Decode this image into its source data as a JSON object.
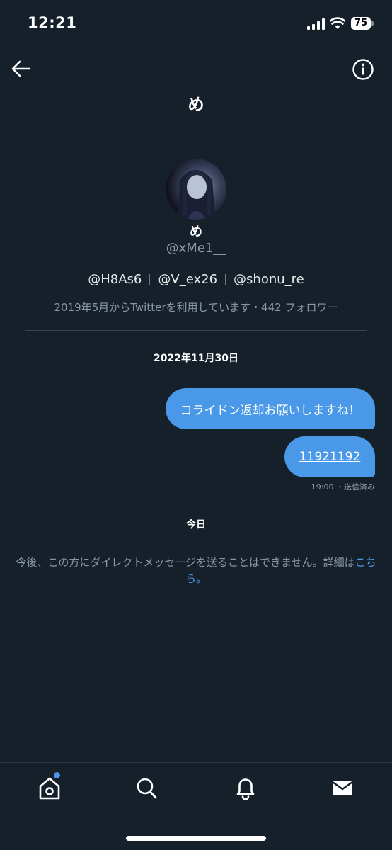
{
  "status_bar": {
    "time": "12:21",
    "battery": "75"
  },
  "header": {
    "title": "め",
    "back_icon": "arrow-left-icon",
    "info_icon": "info-circle-icon"
  },
  "profile": {
    "name": "め",
    "handle": "@xMe1__",
    "mutuals": [
      "@H8As6",
      "@V_ex26",
      "@shonu_re"
    ],
    "joined": "2019年5月からTwitterを利用しています・442 フォロワー"
  },
  "conversation": {
    "date": "2022年11月30日",
    "messages": [
      {
        "text": "コライドン返却お願いしますね！"
      },
      {
        "text": "11921192"
      }
    ],
    "meta": "19:00 ・送信済み",
    "today_label": "今日",
    "notice": "今後、この方にダイレクトメッセージを送ることはできません。詳細は",
    "notice_link": "こちら。"
  },
  "bottom_nav": {
    "items": [
      {
        "icon": "home-icon"
      },
      {
        "icon": "search-icon"
      },
      {
        "icon": "bell-icon"
      },
      {
        "icon": "mail-icon"
      }
    ]
  },
  "colors": {
    "background": "#15202b",
    "accent": "#4a99e9",
    "secondary_text": "#8b98a5"
  }
}
